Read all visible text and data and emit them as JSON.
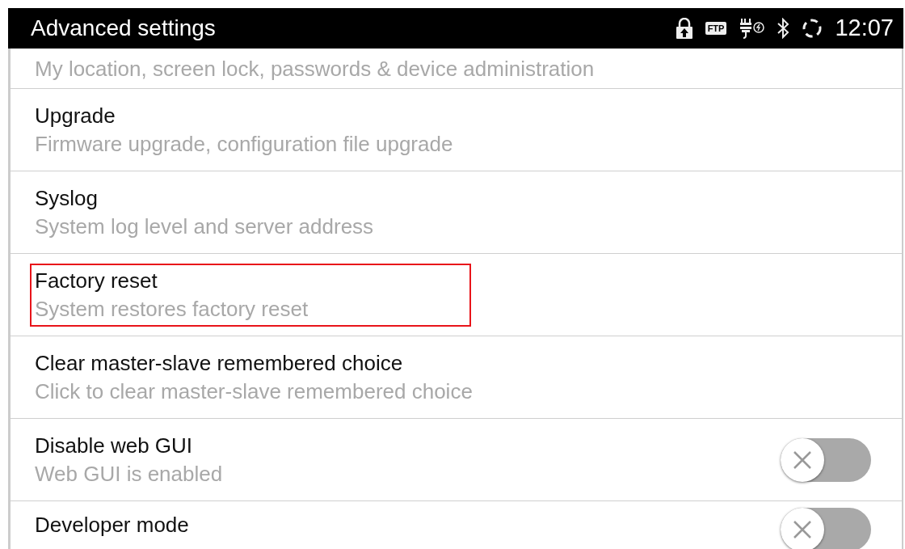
{
  "status_bar": {
    "title": "Advanced settings",
    "ftp_badge": "FTP",
    "time": "12:07"
  },
  "settings": [
    {
      "kind": "text",
      "summary": "My location, screen lock, passwords & device administration",
      "highlighted": false
    },
    {
      "kind": "text",
      "title": "Upgrade",
      "summary": "Firmware upgrade, configuration file upgrade",
      "highlighted": false
    },
    {
      "kind": "text",
      "title": "Syslog",
      "summary": "System log level and server address",
      "highlighted": false
    },
    {
      "kind": "text",
      "title": "Factory reset",
      "summary": "System restores factory reset",
      "highlighted": true
    },
    {
      "kind": "text",
      "title": "Clear master-slave remembered choice",
      "summary": "Click to clear master-slave remembered choice",
      "highlighted": false
    },
    {
      "kind": "toggle",
      "title": "Disable web GUI",
      "summary": "Web GUI is enabled",
      "on": false,
      "highlighted": false
    },
    {
      "kind": "toggle",
      "title": "Developer mode",
      "on": false,
      "highlighted": false
    }
  ]
}
